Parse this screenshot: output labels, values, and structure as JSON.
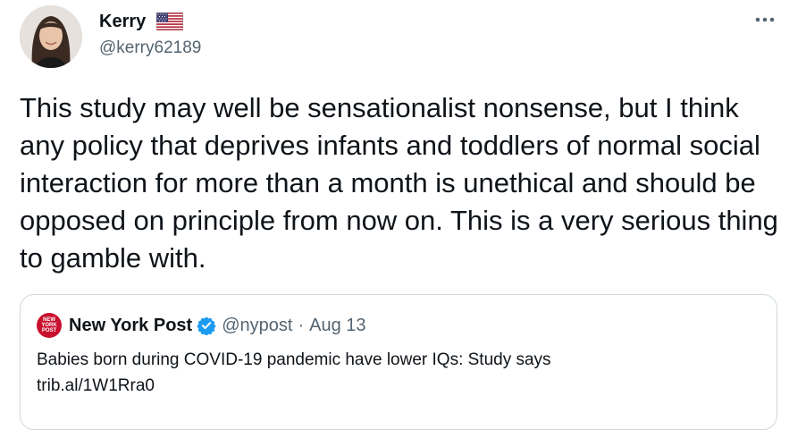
{
  "author": {
    "display_name": "Kerry",
    "flag_icon": "us-flag-icon",
    "handle": "@kerry62189"
  },
  "more_icon": "more-horizontal-icon",
  "tweet": {
    "text": "This study may well be sensationalist nonsense, but I think any policy that deprives infants and toddlers of normal social interaction for more than a month is unethical and should be opposed on principle from now on. This is a very serious thing to gamble with."
  },
  "quoted_tweet": {
    "logo_text": "NEW YORK POST",
    "display_name": "New York Post",
    "verified_icon": "verified-badge-icon",
    "handle": "@nypost",
    "separator": "·",
    "date": "Aug 13",
    "text_line1": "Babies born during COVID-19 pandemic have lower IQs: Study says",
    "text_line2": "trib.al/1W1Rra0"
  },
  "colors": {
    "text": "#0f1419",
    "secondary": "#536471",
    "border": "#cfd9de",
    "verified": "#1d9bf0",
    "nypost_red": "#c8102e"
  }
}
